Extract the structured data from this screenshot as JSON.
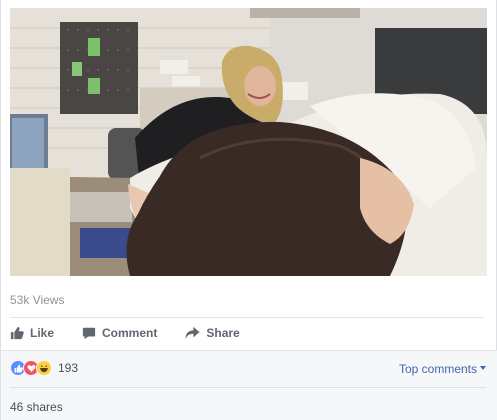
{
  "post": {
    "views": "53k Views"
  },
  "actions": {
    "like_label": "Like",
    "comment_label": "Comment",
    "share_label": "Share"
  },
  "reactions": {
    "types": [
      "like-icon",
      "love-icon",
      "haha-icon"
    ],
    "count": "193"
  },
  "comments": {
    "sort_label": "Top comments"
  },
  "shares": {
    "label": "46 shares"
  },
  "colors": {
    "link": "#4267b2",
    "muted_text": "#90949c",
    "action_text": "#606770",
    "like_blue": "#5890ff",
    "love_red": "#f25268",
    "haha_yellow": "#fcd03e"
  }
}
